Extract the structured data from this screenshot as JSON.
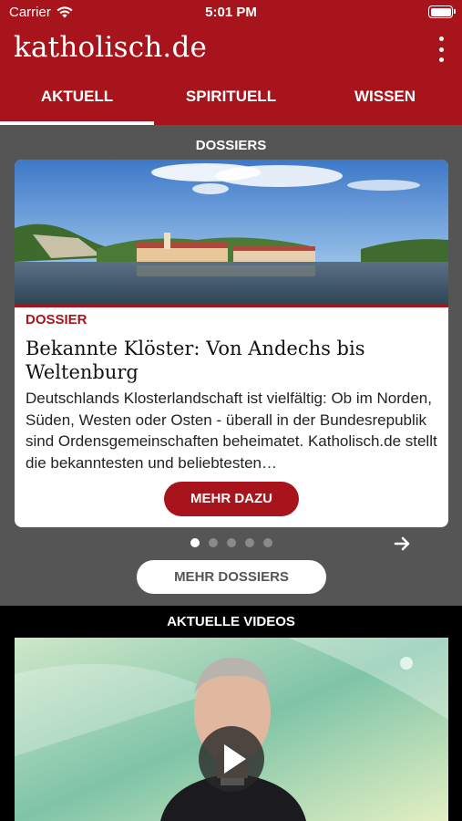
{
  "status_bar": {
    "carrier": "Carrier",
    "time": "5:01 PM"
  },
  "header": {
    "brand": "katholisch.de",
    "menu_icon": "more-vertical-icon"
  },
  "tabs": [
    {
      "label": "AKTUELL",
      "active": true
    },
    {
      "label": "SPIRITUELL",
      "active": false
    },
    {
      "label": "WISSEN",
      "active": false
    }
  ],
  "dossiers": {
    "section_title": "DOSSIERS",
    "card": {
      "kicker": "DOSSIER",
      "headline": "Bekannte Klöster: Von Andechs bis Weltenburg",
      "teaser": "Deutschlands Klosterlandschaft ist vielfältig: Ob im Norden, Süden, Westen oder Osten - überall in der Bundesrepublik sind Ordensgemeinschaften beheimatet. Katholisch.de stellt die bekanntesten und beliebtesten…",
      "button_label": "MEHR DAZU"
    },
    "pager": {
      "count": 5,
      "active_index": 0
    },
    "more_button_label": "MEHR DOSSIERS"
  },
  "videos": {
    "section_title": "AKTUELLE VIDEOS"
  },
  "colors": {
    "brand_red": "#a8141b",
    "section_bg": "#555555",
    "videos_bg": "#000000"
  }
}
